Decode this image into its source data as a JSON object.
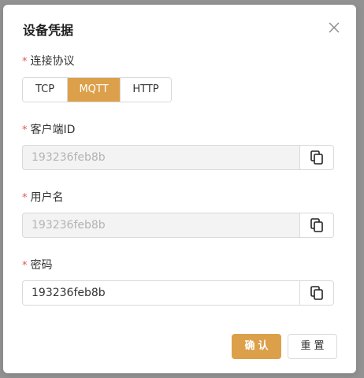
{
  "dialog": {
    "title": "设备凭据"
  },
  "protocol": {
    "required_mark": "*",
    "label": "连接协议",
    "options": [
      "TCP",
      "MQTT",
      "HTTP"
    ],
    "selected": "MQTT"
  },
  "client_id": {
    "required_mark": "*",
    "label": "客户端ID",
    "value": "193236feb8b"
  },
  "username": {
    "required_mark": "*",
    "label": "用户名",
    "value": "193236feb8b"
  },
  "password": {
    "required_mark": "*",
    "label": "密码",
    "value": "193236feb8b"
  },
  "footer": {
    "confirm_label": "确认",
    "reset_label": "重置"
  },
  "colors": {
    "accent": "#dca04a",
    "required": "#e2574c",
    "overlay": "#929292"
  },
  "icons": {
    "close": "close-icon",
    "copy": "copy-icon"
  }
}
